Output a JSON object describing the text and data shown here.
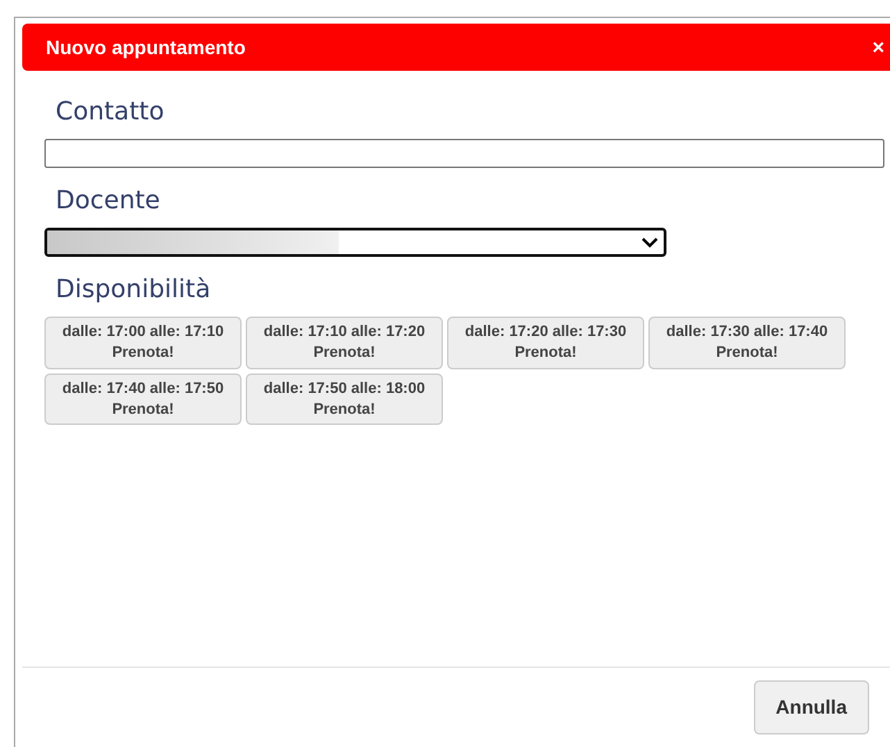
{
  "dialog": {
    "title": "Nuovo appuntamento",
    "close": "×"
  },
  "fields": [
    {
      "label": "Contatto",
      "kind": "text"
    },
    {
      "label": "Docente",
      "kind": "select"
    }
  ],
  "availability": {
    "label": "Disponibilità",
    "slots": [
      {
        "time": "dalle: 17:00 alle: 17:10",
        "action": "Prenota!"
      },
      {
        "time": "dalle: 17:10 alle: 17:20",
        "action": "Prenota!"
      },
      {
        "time": "dalle: 17:20 alle: 17:30",
        "action": "Prenota!"
      },
      {
        "time": "dalle: 17:30 alle: 17:40",
        "action": "Prenota!"
      },
      {
        "time": "dalle: 17:40 alle: 17:50",
        "action": "Prenota!"
      },
      {
        "time": "dalle: 17:50 alle: 18:00",
        "action": "Prenota!"
      }
    ]
  },
  "footer": {
    "cancel": "Annulla"
  }
}
